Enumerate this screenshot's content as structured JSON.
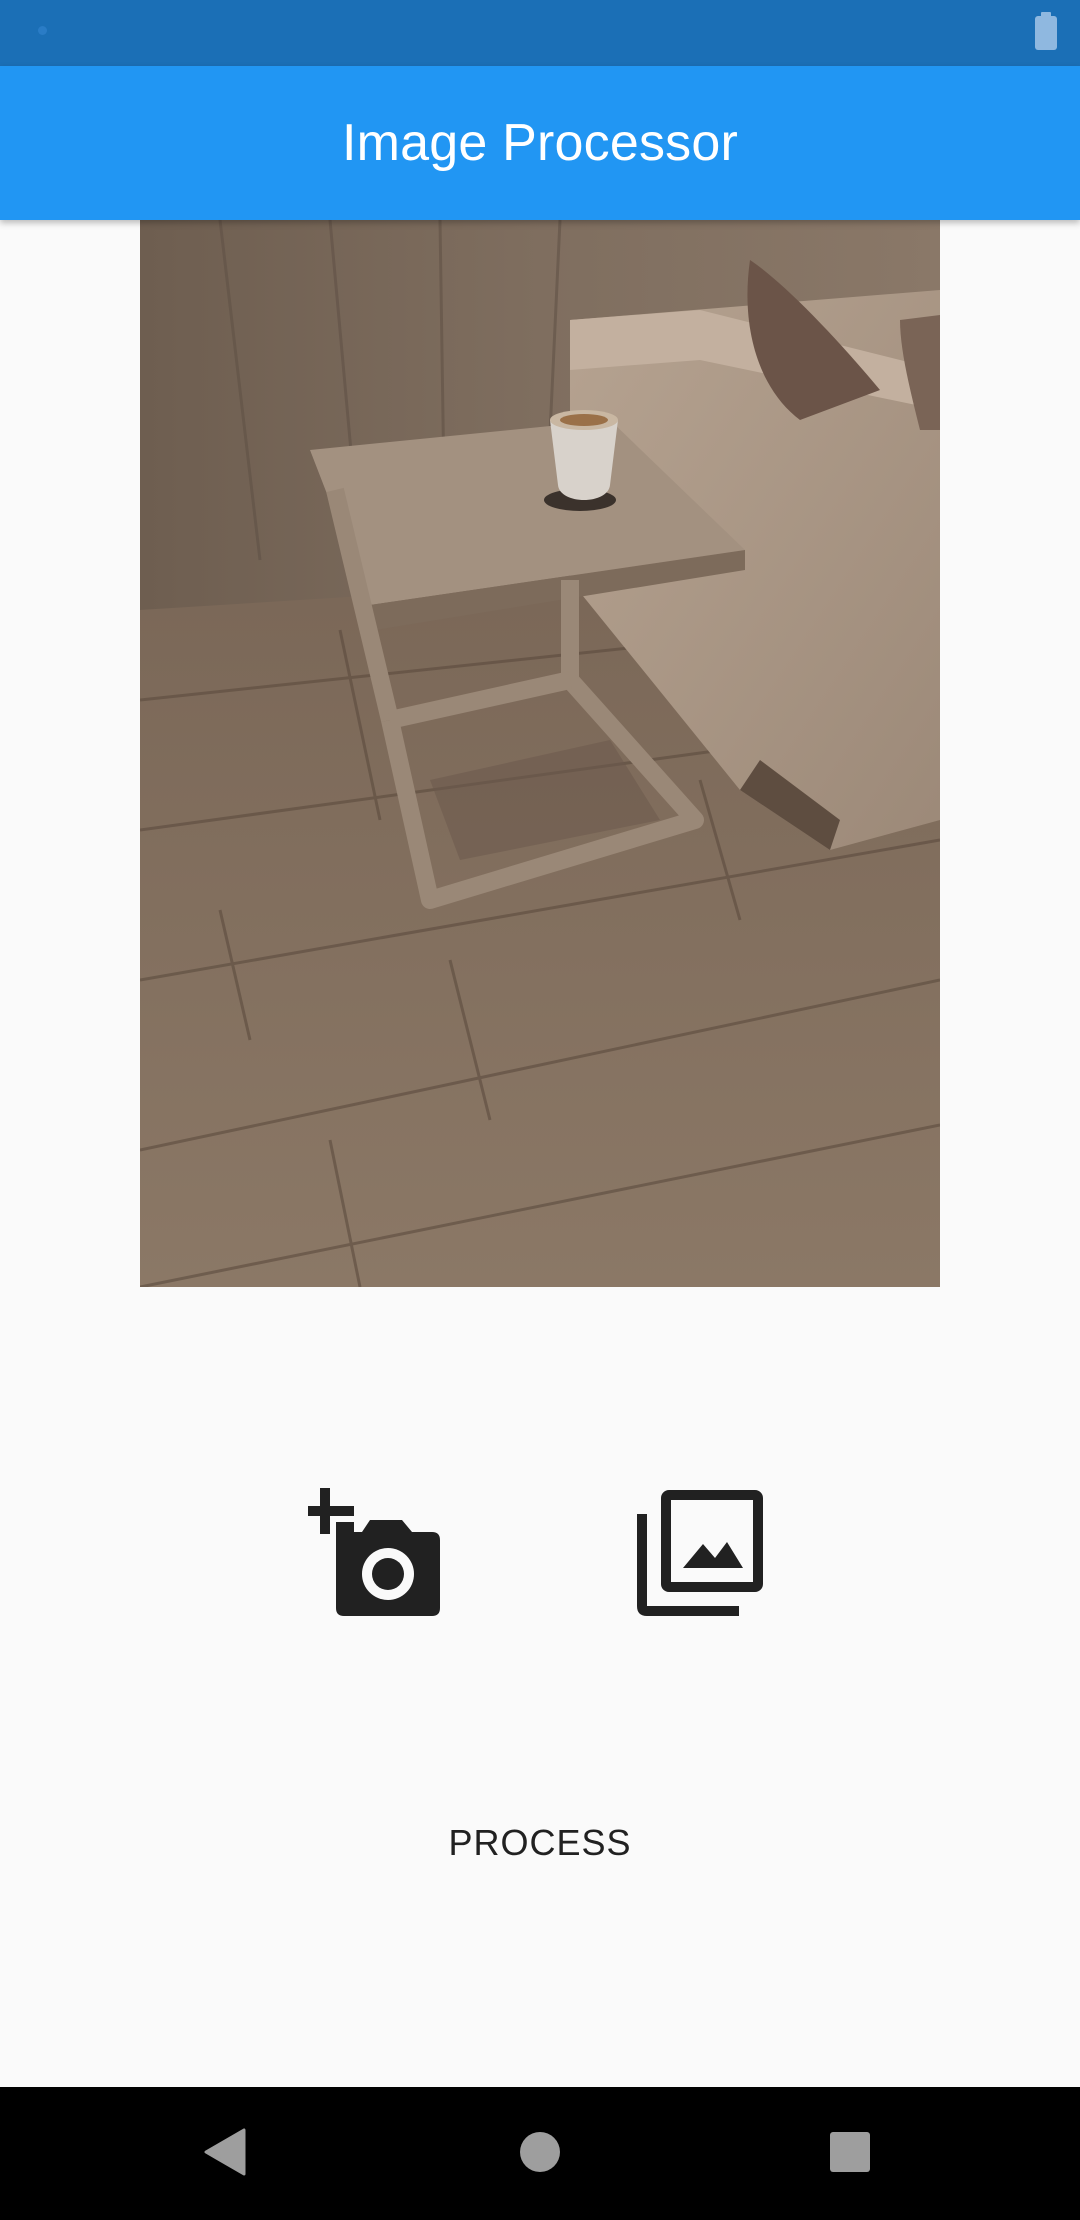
{
  "status_bar": {
    "background": "#1b6fb6",
    "icons": [
      "notification-dot-icon",
      "battery-icon"
    ]
  },
  "app_bar": {
    "title": "Image Processor",
    "background": "#2196f3"
  },
  "photo": {
    "subject": "sepia-toned photo of a side table with a coffee cup next to a sofa on a wooden floor"
  },
  "actions": {
    "camera_icon": "add-a-photo-icon",
    "gallery_icon": "photo-library-icon",
    "process_label": "PROCESS"
  },
  "nav_bar": {
    "background": "#000000",
    "buttons": [
      "back-icon",
      "home-icon",
      "recents-icon"
    ]
  }
}
